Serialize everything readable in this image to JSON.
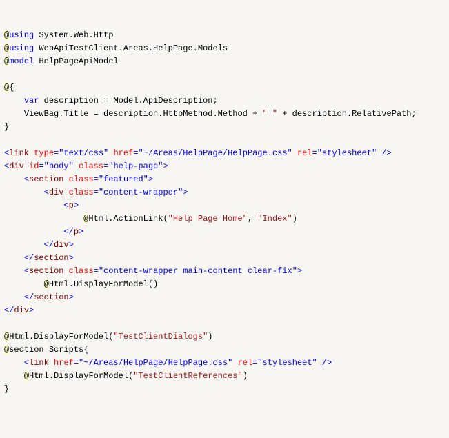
{
  "lines": {
    "l1": {
      "a": "@",
      "b": "using",
      " ": " ",
      "c": "System.Web.Http"
    },
    "l2": {
      "a": "@",
      "b": "using",
      " ": " ",
      "c": "WebApiTestClient.Areas.HelpPage.Models"
    },
    "l3": {
      "a": "@",
      "b": "model",
      " ": " ",
      "c": "HelpPageApiModel"
    },
    "l4": "",
    "l5": {
      "a": "@",
      "b": "{"
    },
    "l6": {
      "indent": "    ",
      "a": "var",
      "b": " description = Model.ApiDescription;"
    },
    "l7": {
      "indent": "    ",
      "a": "ViewBag.Title = description.HttpMethod.Method + ",
      "s1": "\" \"",
      "b": " + description.RelativePath;"
    },
    "l8": "}",
    "l9": "",
    "l10": {
      "open": "<",
      "tag": "link",
      "sp": " ",
      "a1": "type",
      "v1": "\"text/css\"",
      "a2": "href",
      "v2": "\"~/Areas/HelpPage/HelpPage.css\"",
      "a3": "rel",
      "v3": "\"stylesheet\"",
      "close": " />"
    },
    "l11": {
      "open": "<",
      "tag": "div",
      "sp": " ",
      "a1": "id",
      "v1": "\"body\"",
      "a2": "class",
      "v2": "\"help-page\"",
      "close": ">"
    },
    "l12": {
      "indent": "    ",
      "open": "<",
      "tag": "section",
      "sp": " ",
      "a1": "class",
      "v1": "\"featured\"",
      "close": ">"
    },
    "l13": {
      "indent": "        ",
      "open": "<",
      "tag": "div",
      "sp": " ",
      "a1": "class",
      "v1": "\"content-wrapper\"",
      "close": ">"
    },
    "l14": {
      "indent": "            ",
      "open": "<",
      "tag": "p",
      "close": ">"
    },
    "l15": {
      "indent": "                ",
      "r": "@",
      "t": "Html",
      "m": ".ActionLink(",
      "s1": "\"Help Page Home\"",
      "c": ", ",
      "s2": "\"Index\"",
      "e": ")"
    },
    "l16": {
      "indent": "            ",
      "open": "</",
      "tag": "p",
      "close": ">"
    },
    "l17": {
      "indent": "        ",
      "open": "</",
      "tag": "div",
      "close": ">"
    },
    "l18": {
      "indent": "    ",
      "open": "</",
      "tag": "section",
      "close": ">"
    },
    "l19": {
      "indent": "    ",
      "open": "<",
      "tag": "section",
      "sp": " ",
      "a1": "class",
      "v1": "\"content-wrapper main-content clear-fix\"",
      "close": ">"
    },
    "l20": {
      "indent": "        ",
      "r": "@",
      "t": "Html",
      "m": ".DisplayForModel()"
    },
    "l21": {
      "indent": "    ",
      "open": "</",
      "tag": "section",
      "close": ">"
    },
    "l22": {
      "open": "</",
      "tag": "div",
      "close": ">"
    },
    "l23": "",
    "l24": {
      "r": "@",
      "t": "Html",
      "m": ".DisplayForModel(",
      "s1": "\"TestClientDialogs\"",
      "e": ")"
    },
    "l25": {
      "r": "@",
      "b": "section Scripts{"
    },
    "l26": {
      "indent": "    ",
      "open": "<",
      "tag": "link",
      "sp": " ",
      "a1": "href",
      "v1": "\"~/Areas/HelpPage/HelpPage.css\"",
      "a2": "rel",
      "v2": "\"stylesheet\"",
      "close": " />"
    },
    "l27": {
      "indent": "    ",
      "r": "@",
      "t": "Html",
      "m": ".DisplayForModel(",
      "s1": "\"TestClientReferences\"",
      "e": ")"
    },
    "l28": "}"
  }
}
